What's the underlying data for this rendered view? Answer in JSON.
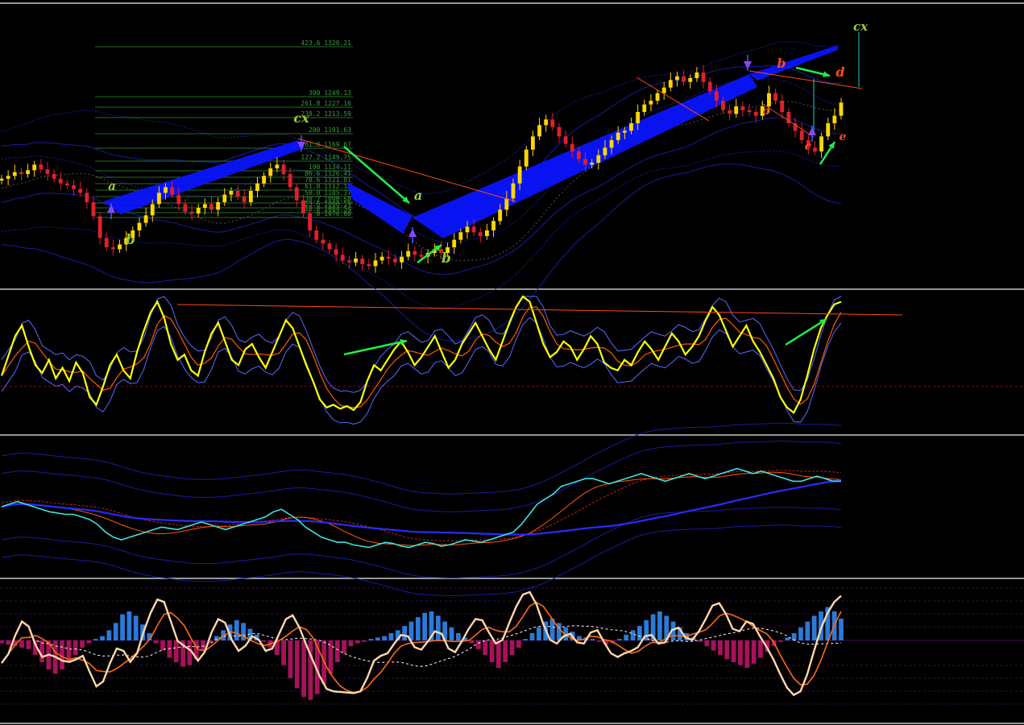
{
  "window": {
    "title": ""
  },
  "colors": {
    "background": "#000000",
    "separator": "#c8c8c8",
    "bull_candle": "#ffd700",
    "bear_candle": "#e0202a",
    "channel_fill": "#0a14ff",
    "envelope": "#1a1aa0",
    "fib_line": "#2f8f2f",
    "fib_text": "#3c9a3c",
    "stoch_main": "#ffff00",
    "stoch_signal": "#ff5a00",
    "stoch_band": "#5a6aff",
    "rsi_line": "#40e0e0",
    "rsi_ma_slow": "#2a2aff",
    "macd_pos": "#2a7ad8",
    "macd_neg": "#a8125a",
    "macd_main": "#ffd8a8",
    "macd_signal": "#ff6a10",
    "trend_line": "#ff4a10",
    "arrow_green": "#22ee44",
    "label_green": "#9acd32",
    "label_red": "#ff4a1a"
  },
  "fibonacci": [
    {
      "text": "423.6 1320.21"
    },
    {
      "text": "300 1249.13"
    },
    {
      "text": "261.8 1227.16"
    },
    {
      "text": "238.2 1213.59"
    },
    {
      "text": "200 1191.63"
    },
    {
      "text": "161.8 1169.67"
    },
    {
      "text": "127.2 1149.75"
    },
    {
      "text": "100 1134.11"
    },
    {
      "text": "86.6 1126.41"
    },
    {
      "text": "78.6 1121.81"
    },
    {
      "text": "61.8 1112.15"
    },
    {
      "text": "50.0 1105.37"
    },
    {
      "text": "38.2 1098.58"
    },
    {
      "text": "23.6 1090.19"
    },
    {
      "text": "13.8 1084.54"
    },
    {
      "text": "0 1076.60"
    }
  ],
  "wave_labels": [
    {
      "text": "a",
      "color": "label_green"
    },
    {
      "text": "b",
      "color": "label_green"
    },
    {
      "text": "cx",
      "color": "label_green"
    },
    {
      "text": "a",
      "color": "label_green"
    },
    {
      "text": "b",
      "color": "label_green"
    },
    {
      "text": "b",
      "color": "label_red"
    },
    {
      "text": "d",
      "color": "label_red"
    },
    {
      "text": "a",
      "color": "label_red"
    },
    {
      "text": "c",
      "color": "label_red"
    },
    {
      "text": "e",
      "color": "label_red"
    },
    {
      "text": "cx",
      "color": "label_green"
    }
  ],
  "chart_data": [
    {
      "panel": "price",
      "type": "candlestick",
      "title": "",
      "ylim": [
        1040,
        1340
      ],
      "close": [
        1155,
        1158,
        1162,
        1160,
        1164,
        1170,
        1165,
        1160,
        1155,
        1150,
        1148,
        1144,
        1140,
        1130,
        1115,
        1092,
        1082,
        1080,
        1085,
        1092,
        1100,
        1108,
        1116,
        1128,
        1140,
        1146,
        1138,
        1128,
        1120,
        1118,
        1124,
        1128,
        1122,
        1130,
        1138,
        1142,
        1136,
        1130,
        1142,
        1150,
        1158,
        1166,
        1170,
        1160,
        1146,
        1132,
        1118,
        1100,
        1090,
        1086,
        1080,
        1074,
        1068,
        1066,
        1070,
        1064,
        1062,
        1068,
        1072,
        1070,
        1066,
        1072,
        1078,
        1074,
        1072,
        1076,
        1080,
        1076,
        1082,
        1090,
        1098,
        1104,
        1098,
        1094,
        1100,
        1110,
        1122,
        1134,
        1150,
        1168,
        1186,
        1200,
        1212,
        1218,
        1210,
        1200,
        1192,
        1184,
        1176,
        1170,
        1172,
        1180,
        1188,
        1196,
        1204,
        1206,
        1214,
        1226,
        1234,
        1238,
        1246,
        1252,
        1260,
        1264,
        1258,
        1262,
        1268,
        1258,
        1248,
        1238,
        1228,
        1224,
        1232,
        1228,
        1226,
        1222,
        1232,
        1246,
        1238,
        1226,
        1214,
        1206,
        1196,
        1188,
        1184,
        1200,
        1214,
        1222,
        1236
      ],
      "lines": [
        {
          "name": "",
          "note": "envelope bands (blue)"
        }
      ]
    },
    {
      "panel": "oscillator-1",
      "type": "line",
      "title": "",
      "ylim": [
        0,
        100
      ],
      "series": [
        {
          "name": "",
          "values": [
            40,
            55,
            70,
            78,
            62,
            48,
            42,
            52,
            38,
            46,
            36,
            50,
            42,
            24,
            18,
            32,
            48,
            56,
            44,
            38,
            58,
            74,
            88,
            96,
            84,
            64,
            52,
            56,
            44,
            40,
            58,
            72,
            80,
            66,
            52,
            48,
            60,
            64,
            54,
            46,
            58,
            70,
            82,
            76,
            62,
            48,
            36,
            22,
            16,
            18,
            15,
            17,
            14,
            20,
            36,
            48,
            44,
            52,
            60,
            66,
            58,
            48,
            54,
            62,
            70,
            58,
            46,
            52,
            64,
            72,
            80,
            70,
            60,
            52,
            66,
            80,
            92,
            100,
            96,
            80,
            64,
            54,
            58,
            66,
            62,
            52,
            60,
            70,
            64,
            50,
            46,
            44,
            52,
            48,
            58,
            66,
            60,
            52,
            62,
            72,
            66,
            56,
            62,
            70,
            82,
            92,
            86,
            74,
            62,
            70,
            78,
            66,
            58,
            48,
            38,
            24,
            16,
            12,
            22,
            40,
            60,
            76,
            86,
            94,
            96
          ]
        }
      ],
      "hline": 32
    },
    {
      "panel": "oscillator-2",
      "type": "line",
      "title": "",
      "ylim": [
        0,
        100
      ],
      "series": [
        {
          "name": "",
          "values": [
            50,
            52,
            54,
            52,
            50,
            48,
            46,
            45,
            44,
            44,
            42,
            40,
            36,
            30,
            26,
            24,
            26,
            28,
            30,
            32,
            34,
            33,
            32,
            34,
            36,
            38,
            36,
            34,
            32,
            34,
            36,
            38,
            40,
            42,
            46,
            48,
            44,
            40,
            34,
            30,
            26,
            24,
            22,
            22,
            20,
            19,
            18,
            20,
            22,
            21,
            19,
            18,
            20,
            22,
            21,
            19,
            20,
            22,
            24,
            23,
            22,
            24,
            26,
            28,
            30,
            36,
            44,
            52,
            56,
            60,
            66,
            68,
            70,
            72,
            72,
            70,
            68,
            70,
            72,
            74,
            76,
            74,
            72,
            70,
            72,
            74,
            76,
            74,
            72,
            74,
            76,
            78,
            80,
            78,
            76,
            78,
            76,
            74,
            72,
            70,
            70,
            72,
            74,
            72,
            70,
            70
          ]
        }
      ]
    },
    {
      "panel": "oscillator-3",
      "type": "bar",
      "title": "",
      "ylim": [
        -100,
        100
      ],
      "values": [
        -4,
        -6,
        -8,
        -10,
        -12,
        -20,
        -30,
        -40,
        -46,
        -40,
        -30,
        -20,
        -10,
        -4,
        2,
        6,
        14,
        24,
        36,
        40,
        34,
        22,
        10,
        -4,
        -14,
        -24,
        -30,
        -36,
        -34,
        -26,
        -14,
        -4,
        6,
        14,
        22,
        28,
        24,
        16,
        8,
        -2,
        -10,
        -20,
        -34,
        -52,
        -66,
        -78,
        -82,
        -74,
        -60,
        -46,
        -30,
        -18,
        -8,
        -4,
        -2,
        2,
        4,
        6,
        10,
        14,
        20,
        26,
        32,
        38,
        40,
        34,
        26,
        18,
        10,
        4,
        -4,
        -12,
        -20,
        -30,
        -38,
        -30,
        -20,
        -10,
        2,
        10,
        18,
        26,
        30,
        24,
        18,
        12,
        6,
        4,
        2,
        -2,
        -6,
        -4,
        2,
        8,
        14,
        20,
        28,
        36,
        40,
        34,
        26,
        18,
        10,
        4,
        -2,
        -8,
        -14,
        -20,
        -26,
        -30,
        -34,
        -38,
        -32,
        -24,
        -16,
        -8,
        -2,
        4,
        10,
        18,
        26,
        34,
        40,
        46,
        40,
        30
      ]
    }
  ]
}
